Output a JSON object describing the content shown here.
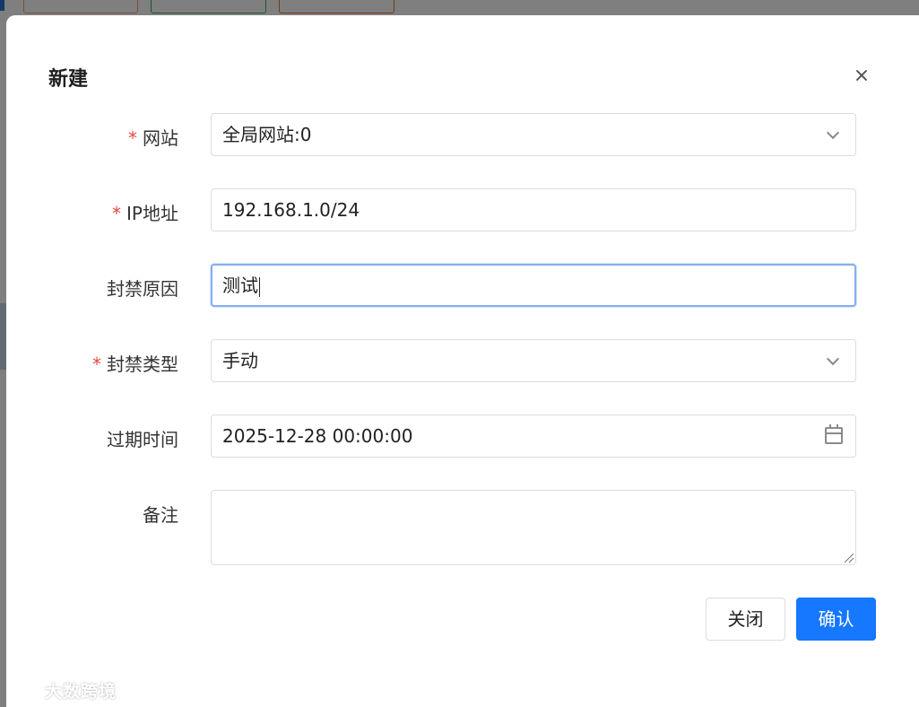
{
  "dialog": {
    "title": "新建",
    "fields": {
      "site": {
        "label": "网站",
        "required": true,
        "value": "全局网站:0"
      },
      "ip": {
        "label": "IP地址",
        "required": true,
        "value": "192.168.1.0/24"
      },
      "reason": {
        "label": "封禁原因",
        "required": false,
        "value": "测试"
      },
      "ban_type": {
        "label": "封禁类型",
        "required": true,
        "value": "手动"
      },
      "expire": {
        "label": "过期时间",
        "required": false,
        "value": "2025-12-28 00:00:00"
      },
      "note": {
        "label": "备注",
        "required": false,
        "value": ""
      }
    },
    "buttons": {
      "close": "关闭",
      "confirm": "确认"
    }
  },
  "watermark": {
    "text": "大数跨境"
  },
  "colors": {
    "primary": "#1677ff",
    "required_star": "#e5483e",
    "mask": "rgba(0,0,0,0.5)"
  },
  "icons": [
    "close-icon",
    "chevron-down-icon",
    "calendar-icon"
  ]
}
